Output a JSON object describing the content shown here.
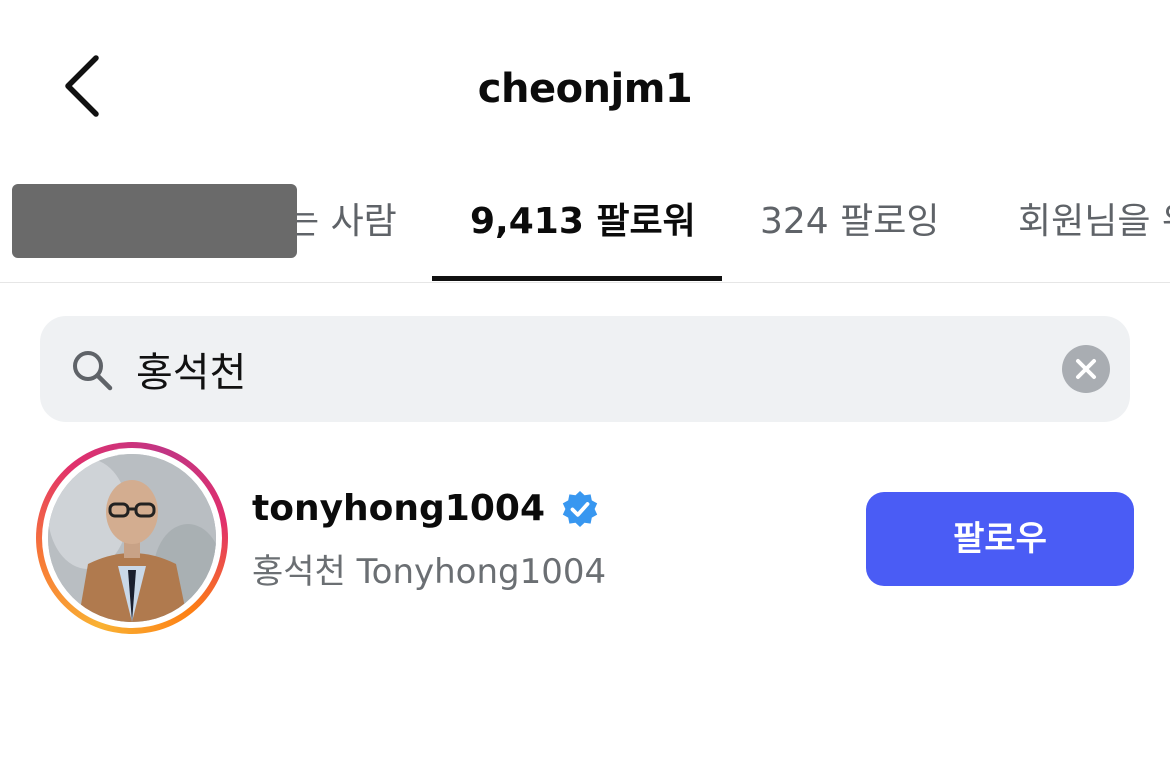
{
  "header": {
    "title": "cheonjm1",
    "back_icon": "chevron-left-icon"
  },
  "tabs": [
    {
      "label": "는 사람",
      "active": false
    },
    {
      "label": "9,413 팔로워",
      "active": true
    },
    {
      "label": "324 팔로잉",
      "active": false
    },
    {
      "label": "회원님을 위",
      "active": false
    }
  ],
  "search": {
    "value": "홍석천",
    "placeholder": "검색",
    "icon": "search-icon",
    "clear_icon": "close-circle-icon"
  },
  "results": [
    {
      "username": "tonyhong1004",
      "verified": true,
      "full_name": "홍석천 Tonyhong1004",
      "follow_label": "팔로우",
      "has_story_ring": true
    }
  ],
  "colors": {
    "accent": "#4a5cf5",
    "verified": "#3897f0",
    "tab_active": "#111111",
    "tab_inactive": "#5f6368",
    "search_bg": "#eff1f3"
  }
}
